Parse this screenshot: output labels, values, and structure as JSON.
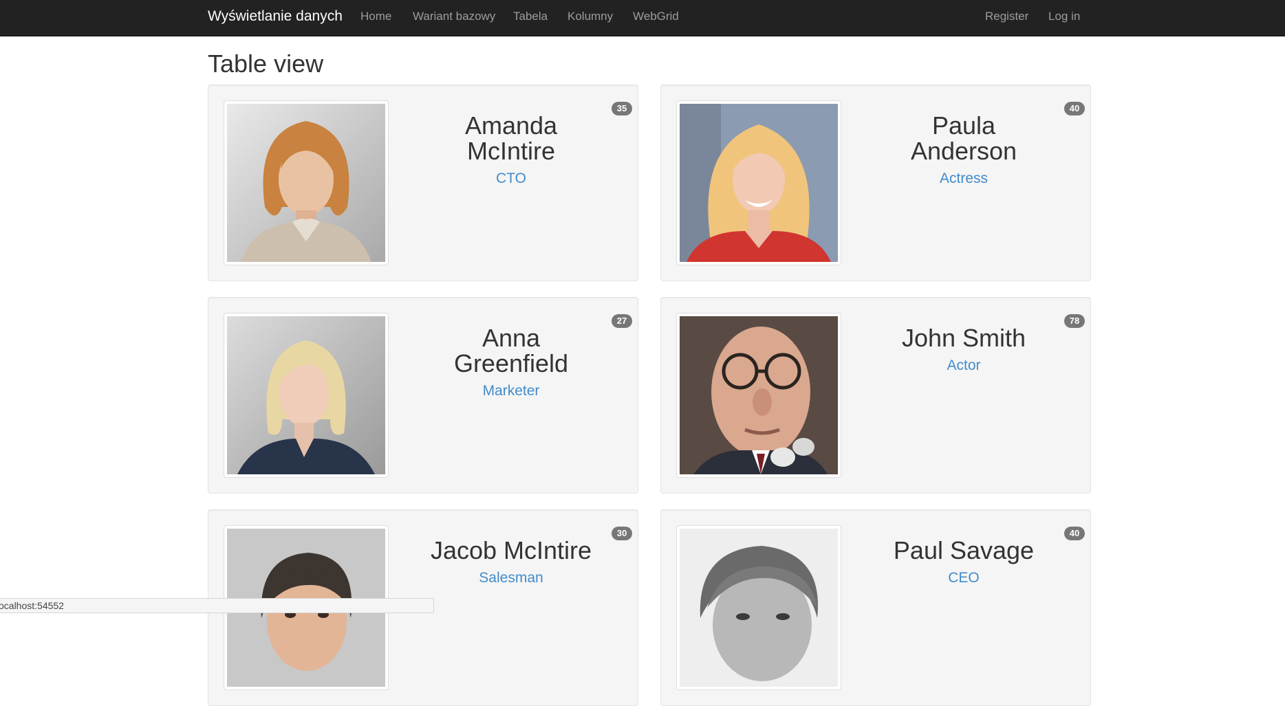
{
  "navbar": {
    "brand": "Wyświetlanie danych",
    "links": [
      "Home",
      "Wariant bazowy",
      "Tabela",
      "Kolumny",
      "WebGrid"
    ],
    "right_links": [
      "Register",
      "Log in"
    ]
  },
  "page": {
    "title": "Table view"
  },
  "people": [
    {
      "name": "Amanda McIntire",
      "role": "CTO",
      "age": "35"
    },
    {
      "name": "Paula Anderson",
      "role": "Actress",
      "age": "40"
    },
    {
      "name": "Anna Greenfield",
      "role": "Marketer",
      "age": "27"
    },
    {
      "name": "John Smith",
      "role": "Actor",
      "age": "78"
    },
    {
      "name": "Jacob McIntire",
      "role": "Salesman",
      "age": "30"
    },
    {
      "name": "Paul Savage",
      "role": "CEO",
      "age": "40"
    }
  ],
  "statusbar": {
    "text": "ocalhost:54552"
  },
  "colors": {
    "navbar_bg": "#222222",
    "brand": "#ffffff",
    "nav_link": "#9d9d9d",
    "card_bg": "#f5f5f5",
    "role_link": "#428bca",
    "badge_bg": "#777777"
  }
}
